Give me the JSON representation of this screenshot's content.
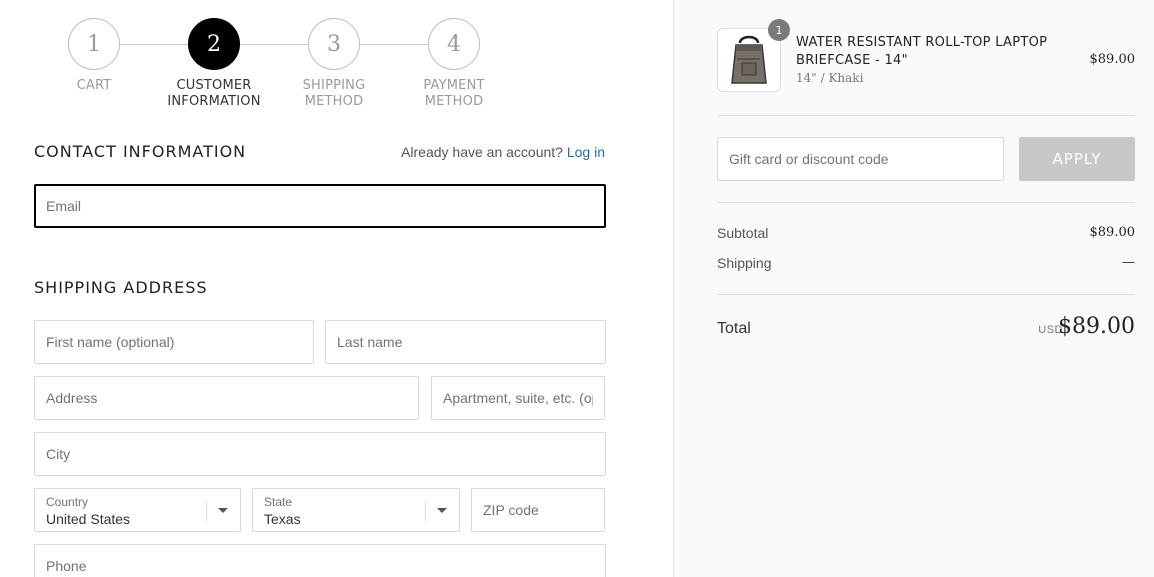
{
  "steps": [
    {
      "number": "1",
      "label_line1": "CART",
      "label_line2": ""
    },
    {
      "number": "2",
      "label_line1": "CUSTOMER",
      "label_line2": "INFORMATION"
    },
    {
      "number": "3",
      "label_line1": "SHIPPING",
      "label_line2": "METHOD"
    },
    {
      "number": "4",
      "label_line1": "PAYMENT",
      "label_line2": "METHOD"
    }
  ],
  "contact": {
    "title": "CONTACT INFORMATION",
    "account_prompt": "Already have an account?",
    "login_link": "Log in",
    "email_placeholder": "Email"
  },
  "shipping": {
    "title": "SHIPPING ADDRESS",
    "first_name_placeholder": "First name (optional)",
    "last_name_placeholder": "Last name",
    "address_placeholder": "Address",
    "apartment_placeholder": "Apartment, suite, etc. (optional)",
    "city_placeholder": "City",
    "country_label": "Country",
    "country_value": "United States",
    "state_label": "State",
    "state_value": "Texas",
    "zip_placeholder": "ZIP code",
    "phone_placeholder": "Phone"
  },
  "order": {
    "quantity": "1",
    "product_name": "WATER RESISTANT ROLL-TOP LAPTOP BRIEFCASE - 14\"",
    "variant": "14\" / Khaki",
    "price": "$89.00",
    "discount_placeholder": "Gift card or discount code",
    "apply_label": "APPLY",
    "subtotal_label": "Subtotal",
    "subtotal_value": "$89.00",
    "shipping_label": "Shipping",
    "shipping_value": "—",
    "total_label": "Total",
    "currency": "USD",
    "total_value": "$89.00"
  }
}
